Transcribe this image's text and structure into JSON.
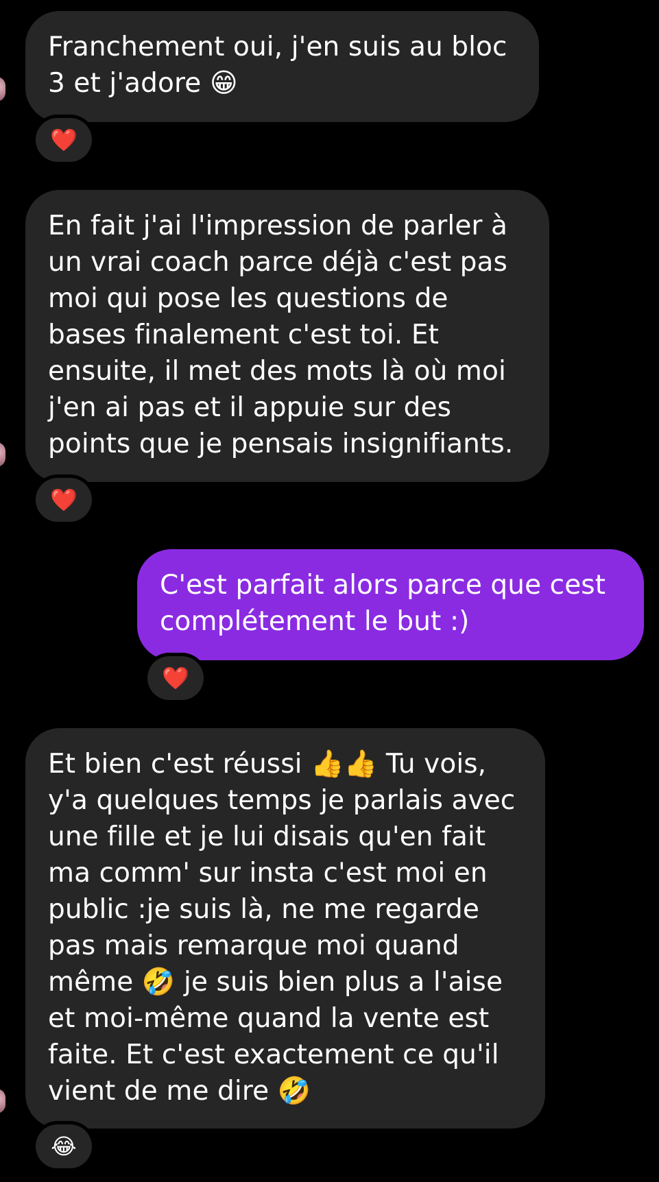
{
  "conversation": {
    "messages": [
      {
        "sender": "other",
        "text": "Franchement oui, j'en suis au bloc\n3 et j'adore 😁",
        "reaction": "❤️"
      },
      {
        "sender": "other",
        "text": "En fait j'ai l'impression de parler à\nun vrai coach parce déjà c'est pas\nmoi qui pose les questions de\nbases finalement c'est toi. Et\nensuite, il met des mots là où moi\nj'en ai pas et il appuie sur des\npoints que je pensais insignifiants.",
        "reaction": "❤️"
      },
      {
        "sender": "me",
        "text": "C'est parfait alors parce que cest\ncomplétement le but :)",
        "reaction": "❤️"
      },
      {
        "sender": "other",
        "text": "Et bien c'est réussi 👍👍 Tu vois,\ny'a quelques temps je parlais avec\nune fille et je lui disais qu'en fait\nma comm' sur insta c'est moi en\npublic :je suis là, ne me regarde\npas mais remarque moi quand\nmême 🤣 je suis bien plus a l'aise\net moi-même quand la vente est\nfaite. Et c'est exactement ce qu'il\nvient de me dire 🤣",
        "reaction": "😂"
      }
    ]
  },
  "colors": {
    "background": "#000000",
    "received_bubble": "#262626",
    "sent_bubble": "#8a2be2",
    "text": "#ffffff"
  }
}
